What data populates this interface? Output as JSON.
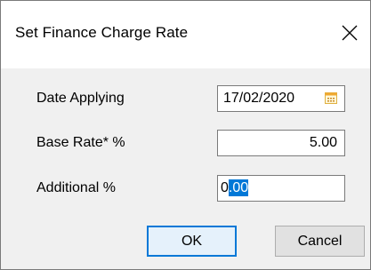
{
  "dialog": {
    "title": "Set Finance Charge Rate",
    "close_icon": "close-icon"
  },
  "form": {
    "date_applying": {
      "label": "Date Applying",
      "value": "17/02/2020",
      "icon": "calendar-icon"
    },
    "base_rate": {
      "label": "Base Rate* %",
      "value": "5.00"
    },
    "additional": {
      "label": "Additional %",
      "value_caret": "0",
      "value_selected": ".00"
    }
  },
  "buttons": {
    "ok_label": "OK",
    "cancel_label": "Cancel"
  },
  "colors": {
    "accent": "#0078d7",
    "ok_background": "#e5f1fb",
    "dialog_background": "#f0f0f0"
  }
}
